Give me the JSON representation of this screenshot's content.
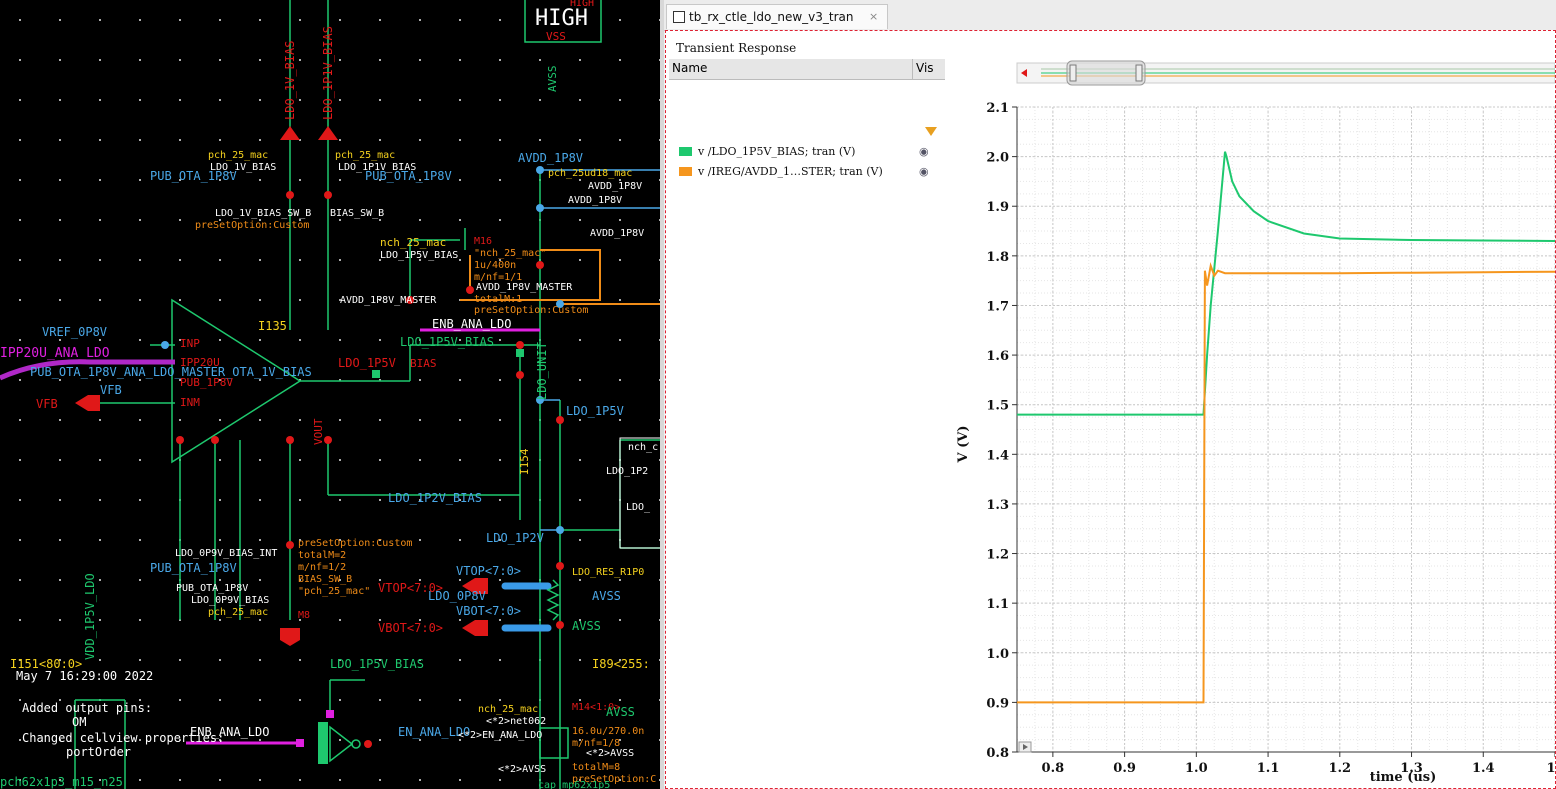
{
  "schematic": {
    "labels": {
      "high": "HIGH",
      "high_small": "HIGH",
      "vss_top": "VSS",
      "avss_top": "AVSS",
      "ldo_1v_bias": "LDO_1V_BIAS",
      "ldo_1p1v_bias": "LDO_1P1V_BIAS",
      "avdd_1p8v": "AVDD_1P8V",
      "pch25_a": "pch_25_mac",
      "pch25_b": "pch_25_mac",
      "ldo_1v_bias_inst": "LDO_1V_BIAS",
      "ldo_1p1v_bias_inst": "LDO_1P1V_BIAS",
      "pub_ota_1p8v_top": "PUB_OTA_1P8V",
      "pub_ota_1p8v_r": "PUB_OTA_1P8V",
      "ldo_1v_bias_sw_b": "LDO_1V_BIAS_SW_B",
      "bias_sw_b": "BIAS_SW_B",
      "preset_custom_1": "preSetOption:Custom",
      "pch_25ud18": "pch_25ud18_mac",
      "avdd_1p8v_b": "AVDD_1P8V",
      "avdd_1p8v_c": "AVDD_1P8V",
      "avdd_1p8v_d": "AVDD_1P8V",
      "nch25_m16": "nch_25_mac",
      "m16": "M16",
      "nch25_quote": "\"nch_25_mac\"",
      "wl_1u": "1u/400n",
      "mnf": "m/nf=1/1",
      "ldo_1p5v_bias_a": "LDO_1P5V_BIAS",
      "avdd_1p8v_master": "AVDD_1P8V_MASTER",
      "avdd_1p8v_master_b": "AVDD_1P8V_MASTER",
      "totalm1": "totalM:1",
      "preset_custom_2": "preSetOption:Custom",
      "enb_ana_ldo": "ENB_ANA_LDO",
      "ldo_1p5v_bias_b": "LDO_1P5V_BIAS",
      "i135": "I135",
      "vref": "VREF_0P8V",
      "ipp20u": "IPP20U_ANA_LDO",
      "inp": "INP",
      "ipp20u_pin": "IPP20U",
      "pub_ota_long": "PUB_OTA_1P8V_ANA_LDO_MASTER_OTA_1V_BIAS",
      "ldo_1p5v": "LDO_1P5V",
      "bias": "BIAS",
      "pub_1p8v": "PUB_1P8V",
      "vfb": "VFB",
      "vfb_pin": "VFB",
      "inm": "INM",
      "vout": "VOUT",
      "ldo_unit": "LDO_UNIT",
      "ldo_1p5v_r": "LDO_1P5V",
      "i154": "I154",
      "ldo_1p2v_bias": "LDO_1P2V_BIAS",
      "ldo_1p2v": "LDO_1P2V",
      "nch_c": "nch_c",
      "ldo_1p2_cut": "LDO_1P2",
      "ldo_cut": "LDO_",
      "ldo_0p9v_bias_int": "LDO_0P9V_BIAS_INT",
      "pub_ota_1p8v_b": "PUB_OTA_1P8V",
      "pub_ota_1p8v_c": "PUB_OTA_1P8V",
      "ldo_0p9v_bias": "LDO_0P9V_BIAS",
      "pch25_c": "pch_25_mac",
      "preset_custom_3": "preSetOption:Custom",
      "totalm2": "totalM=2",
      "mnf12": "m/nf=1/2",
      "bias_sw_b2": "BIAS_SW_B",
      "pch25_quote": "\"pch_25_mac\"",
      "m8": "M8",
      "vtop": "VTOP<7:0>",
      "vbot": "VBOT<7:0>",
      "vtop_r": "VTOP<7:0>",
      "vbot_r": "VBOT<7:0>",
      "ldo_0p8v": "LDO_0P8V",
      "ldo_res": "LDO_RES_R1P0",
      "avss_a": "AVSS",
      "avss_b": "AVSS",
      "ldo_1p5v_bias_c": "LDO_1P5V_BIAS",
      "i151": "I151<80:0>",
      "i89": "I89<255:",
      "date": "May  7 16:29:00 2022",
      "added_pins": "Added output pins:",
      "om": "OM",
      "changed": "Changed cellview properties:",
      "portorder": "portOrder",
      "enb_ana_ldo_b": "ENB_ANA_LDO",
      "en_ana_ldo": "EN_ANA_LDO",
      "nch25_m14": "nch_25_mac",
      "m14": "M14<1:0>",
      "net062": "<*2>net062",
      "en_ana_ldo_2": "<*2>EN_ANA_LDO",
      "wl_16u": "16.0u/270.0n",
      "mnf18": "m/nf=1/8",
      "avss_2": "<*2>AVSS",
      "avss_3": "<*2>AVSS",
      "totalm8": "totalM=8",
      "preset_custom_4": "preSetOption:C",
      "avss_c": "AVSS",
      "vdd_1p5v_ldo": "VDD_1P5V_LDO",
      "pch_bottom": "pch62x1p3_m15_n25",
      "cap_bottom": "cap_mp62x1p5"
    }
  },
  "waveform": {
    "tab_label": "tb_rx_ctle_ldo_new_v3_tran",
    "tab_close": "×",
    "panel_title": "Transient Response",
    "col_name": "Name",
    "col_vis": "Vis",
    "signals": [
      {
        "name": "v /LDO_1P5V_BIAS; tran (V)",
        "color": "#1ec86e"
      },
      {
        "name": "v /IREG/AVDD_1…STER; tran (V)",
        "color": "#f5961e"
      }
    ]
  },
  "chart_data": {
    "type": "line",
    "xlabel": "time (us)",
    "ylabel": "V (V)",
    "xlim": [
      0.75,
      1.5
    ],
    "ylim": [
      0.8,
      2.1
    ],
    "x_ticks": [
      "0.8",
      "0.9",
      "1.0",
      "1.1",
      "1.2",
      "1.3",
      "1.4",
      "1"
    ],
    "y_ticks": [
      "2.1",
      "2.0",
      "1.9",
      "1.8",
      "1.7",
      "1.6",
      "1.5",
      "1.4",
      "1.3",
      "1.2",
      "1.1",
      "1.0",
      "0.9",
      "0.8"
    ],
    "grid": true,
    "series": [
      {
        "name": "v /LDO_1P5V_BIAS; tran (V)",
        "color": "#1ec86e",
        "x": [
          0.75,
          1.0,
          1.01,
          1.015,
          1.02,
          1.03,
          1.04,
          1.042,
          1.05,
          1.06,
          1.08,
          1.1,
          1.15,
          1.2,
          1.3,
          1.4,
          1.5
        ],
        "y": [
          1.48,
          1.48,
          1.48,
          1.6,
          1.7,
          1.85,
          2.01,
          2.0,
          1.95,
          1.92,
          1.89,
          1.87,
          1.845,
          1.835,
          1.832,
          1.831,
          1.83
        ]
      },
      {
        "name": "v /IREG/AVDD_1…STER; tran (V)",
        "color": "#f5961e",
        "x": [
          0.75,
          1.0,
          1.01,
          1.012,
          1.015,
          1.02,
          1.025,
          1.03,
          1.04,
          1.1,
          1.2,
          1.3,
          1.4,
          1.5
        ],
        "y": [
          0.9,
          0.9,
          0.9,
          1.77,
          1.74,
          1.78,
          1.76,
          1.77,
          1.765,
          1.765,
          1.765,
          1.766,
          1.767,
          1.768
        ]
      }
    ]
  }
}
